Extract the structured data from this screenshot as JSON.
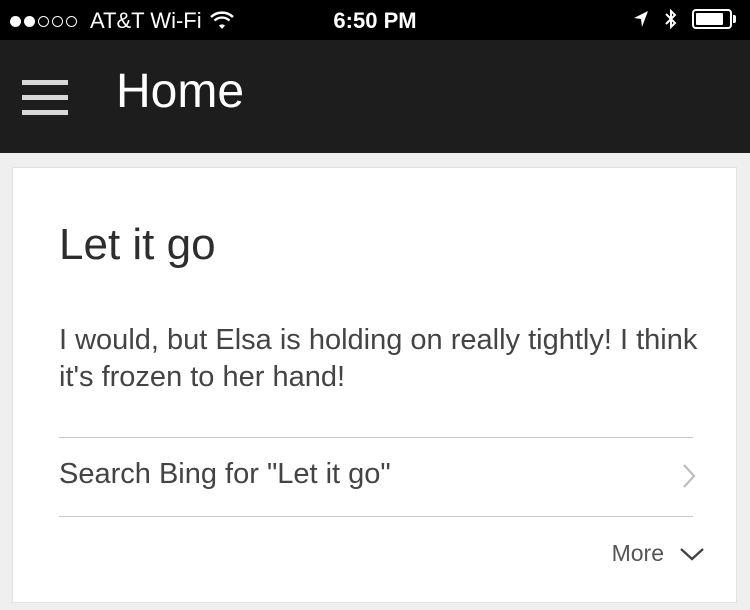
{
  "status_bar": {
    "carrier": "AT&T Wi-Fi",
    "time": "6:50 PM",
    "signal_bars_filled": 2,
    "signal_bars_total": 5,
    "battery_level": 0.85
  },
  "app_bar": {
    "title": "Home",
    "menu_icon": "hamburger-menu-icon"
  },
  "card": {
    "title": "Let it go",
    "body": "I would, but Elsa is holding on really tightly! I think it's frozen to her hand!",
    "search_link": "Search Bing for \"Let it go\"",
    "more_label": "More"
  }
}
